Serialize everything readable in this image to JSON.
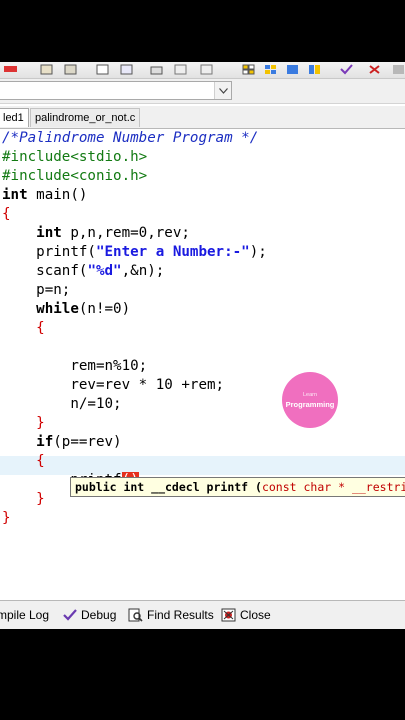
{
  "tabs": [
    {
      "label": "led1",
      "active": true
    },
    {
      "label": "palindrome_or_not.c",
      "active": false
    }
  ],
  "code": {
    "comment": "/*Palindrome Number Program */",
    "include1": "#include<stdio.h>",
    "include2": "#include<conio.h>",
    "kw_int": "int",
    "main_sig": " main()",
    "open_brace": "{",
    "close_brace": "}",
    "decl_rest": " p,n,rem=0,rev;",
    "printf": "printf",
    "prompt_string": "\"Enter a Number:-\"",
    "scanf": "scanf",
    "scanf_fmt": "\"%d\"",
    "scanf_args": ",&n);",
    "assign_p": "p=n;",
    "kw_while": "while",
    "while_cond": "(n!=0)",
    "rem_line": "rem=n%10;",
    "rev_line": "rev=rev * 10 +rem;",
    "div_line": "n/=10;",
    "kw_if": "if",
    "if_cond": "(p==rev)",
    "printf_partial": "printf",
    "paren_pair": "()"
  },
  "calltip": {
    "prefix": "public int __cdecl printf (",
    "param_kw": "const char",
    "param_rest": " * __restrict"
  },
  "logo": {
    "line1": "Learn",
    "line2": "Programming"
  },
  "bottom_tabs": [
    {
      "label": "mpile Log",
      "icon": "compile-log-icon"
    },
    {
      "label": "Debug",
      "icon": "debug-check-icon"
    },
    {
      "label": "Find Results",
      "icon": "find-results-icon"
    },
    {
      "label": "Close",
      "icon": "close-bug-icon"
    }
  ]
}
